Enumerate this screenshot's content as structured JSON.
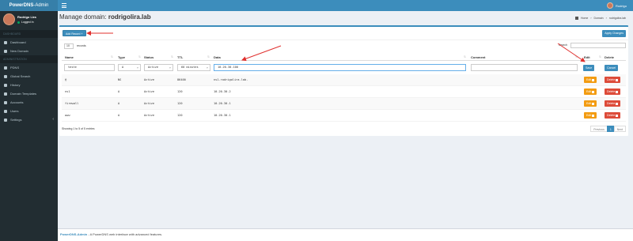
{
  "app": {
    "name_left": "PowerDNS",
    "name_right": "-Admin"
  },
  "user": {
    "name": "Rodrigo Lira",
    "status": "Logged In",
    "top_name": "Rodrigo"
  },
  "sidebar": {
    "sections": [
      {
        "header": "DASHBOARD",
        "items": [
          {
            "label": "Dashboard",
            "icon": "dashboard-icon"
          },
          {
            "label": "New Domain",
            "icon": "plus-icon"
          }
        ]
      },
      {
        "header": "ADMINISTRATION",
        "items": [
          {
            "label": "PDNS",
            "icon": "server-icon"
          },
          {
            "label": "Global Search",
            "icon": "search-icon"
          },
          {
            "label": "History",
            "icon": "history-icon"
          },
          {
            "label": "Domain Templates",
            "icon": "template-icon"
          },
          {
            "label": "Accounts",
            "icon": "accounts-icon"
          },
          {
            "label": "Users",
            "icon": "users-icon"
          },
          {
            "label": "Settings",
            "icon": "gear-icon"
          }
        ]
      }
    ]
  },
  "page": {
    "title_prefix": "Manage domain: ",
    "domain": "rodrigolira.lab",
    "breadcrumb": [
      "Home",
      "Domain",
      "rodrigolira.lab"
    ]
  },
  "toolbar": {
    "add_record": "Add Record",
    "apply_changes": "Apply Changes"
  },
  "table_controls": {
    "length_value": "10",
    "length_label": "records",
    "search_label": "Search"
  },
  "columns": [
    "Name",
    "Type",
    "Status",
    "TTL",
    "Data",
    "Comment",
    "Edit",
    "Delete"
  ],
  "editing_row": {
    "name": "teste",
    "type": "A",
    "status": "Active",
    "ttl": "60 minutes",
    "data": "10.20.30.100",
    "comment": "",
    "save": "Save",
    "cancel": "Cancel"
  },
  "rows": [
    {
      "name": "@",
      "type": "NS",
      "status": "Active",
      "ttl": "86400",
      "data": "ns1.rodrigolira.lab."
    },
    {
      "name": "ns1",
      "type": "A",
      "status": "Active",
      "ttl": "120",
      "data": "10.20.30.2"
    },
    {
      "name": "firewall",
      "type": "A",
      "status": "Active",
      "ttl": "120",
      "data": "10.20.30.1"
    },
    {
      "name": "www",
      "type": "A",
      "status": "Active",
      "ttl": "120",
      "data": "10.20.30.1"
    }
  ],
  "row_actions": {
    "edit": "Edit",
    "delete": "Delete"
  },
  "footer_info": {
    "showing": "Showing 1 to 5 of 5 entries",
    "previous": "Previous",
    "page": "1",
    "next": "Next"
  },
  "footer": {
    "brand": "PowerDNS-Admin",
    "text": " - A PowerDNS web interface with advanced features."
  },
  "colors": {
    "primary": "#3c8dbc",
    "sidebar": "#222d32",
    "edit": "#f39c12",
    "delete": "#dd4b39",
    "arrow": "#e0302e"
  }
}
